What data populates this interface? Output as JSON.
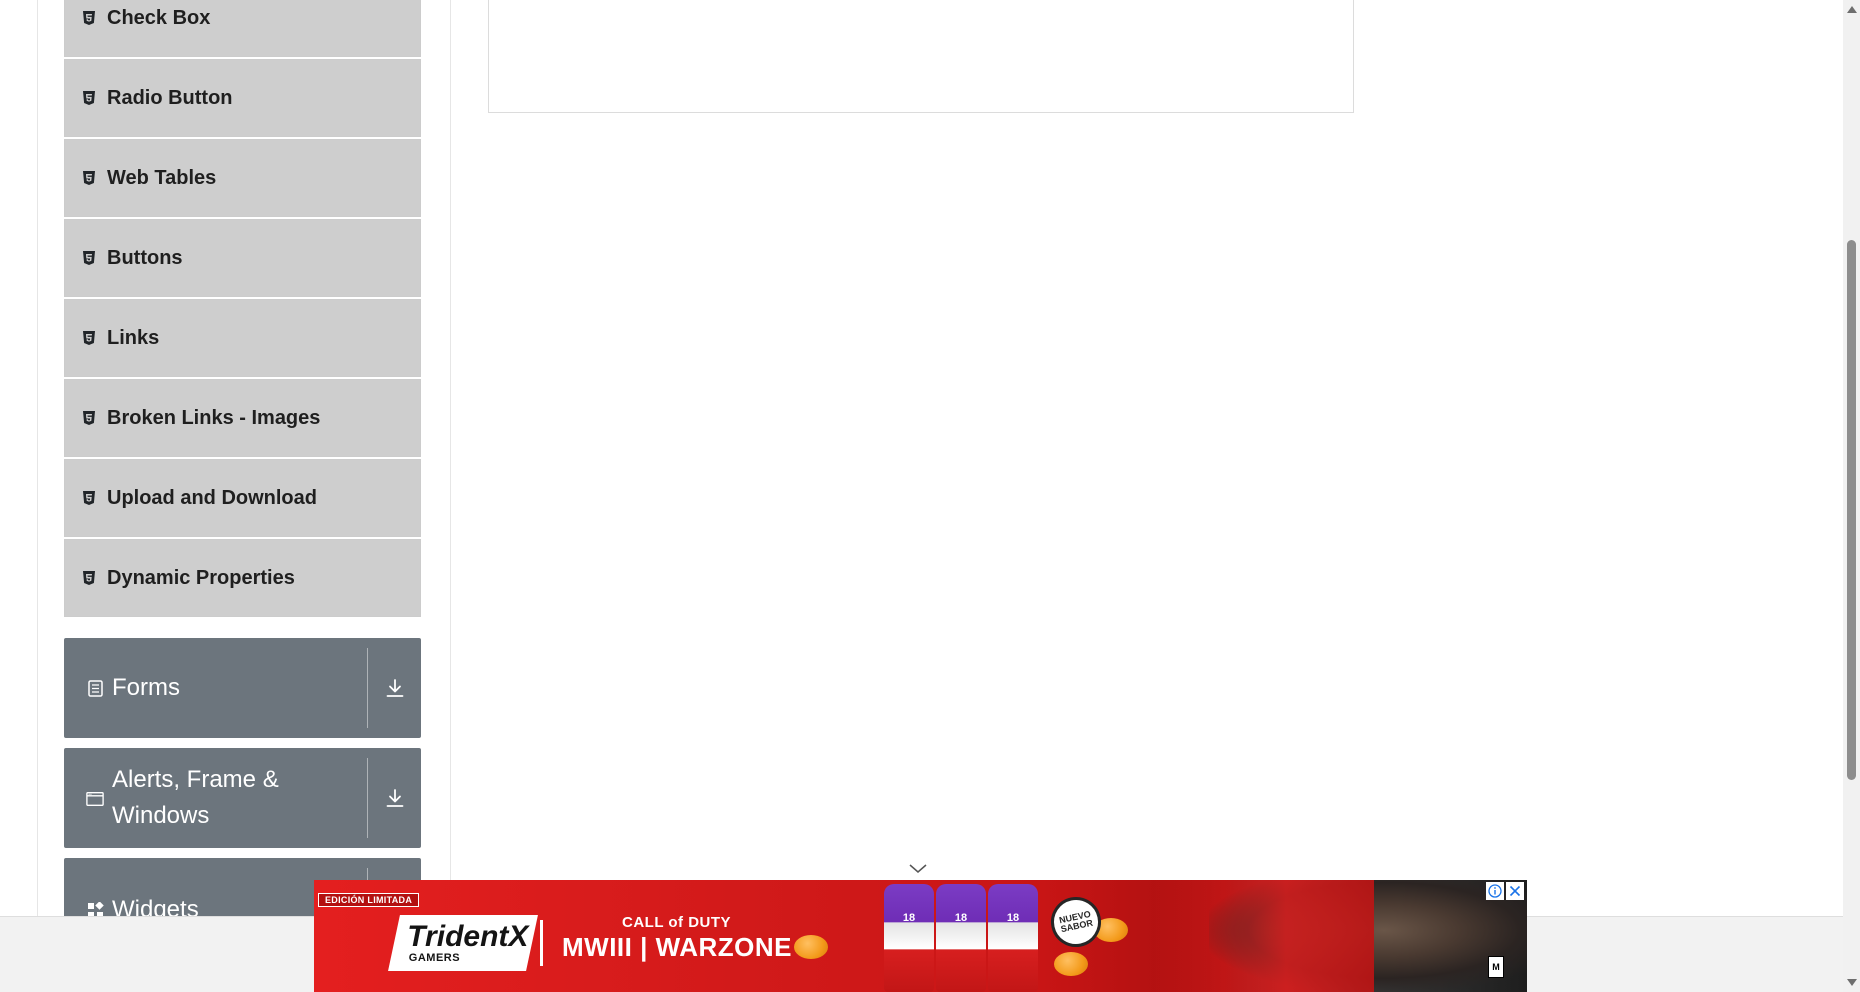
{
  "sidebar": {
    "element_items": [
      {
        "label": "Check Box",
        "icon": "html5-icon"
      },
      {
        "label": "Radio Button",
        "icon": "html5-icon"
      },
      {
        "label": "Web Tables",
        "icon": "html5-icon"
      },
      {
        "label": "Buttons",
        "icon": "html5-icon"
      },
      {
        "label": "Links",
        "icon": "html5-icon"
      },
      {
        "label": "Broken Links - Images",
        "icon": "html5-icon"
      },
      {
        "label": "Upload and Download",
        "icon": "html5-icon"
      },
      {
        "label": "Dynamic Properties",
        "icon": "html5-icon"
      }
    ],
    "groups": [
      {
        "label": "Forms",
        "icon": "form-icon",
        "toggle_icon": "download-arrow-icon"
      },
      {
        "label": "Alerts, Frame & Windows",
        "icon": "window-icon",
        "toggle_icon": "download-arrow-icon"
      },
      {
        "label": "Widgets",
        "icon": "widgets-icon",
        "toggle_icon": "download-arrow-icon"
      }
    ]
  },
  "ad": {
    "badge": "EDICIÓN LIMITADA",
    "brand": "TridentX",
    "brand_sub": "GAMERS",
    "game_line1": "CALL of DUTY",
    "game_line2": "MWIII | WARZONE",
    "can_label": "18",
    "seal": "NUEVO SABOR",
    "rating": "M",
    "collapse_icon": "chevron-down-icon",
    "info_icon": "info-icon",
    "close_icon": "close-icon"
  },
  "colors": {
    "item_bg": "#cecece",
    "group_bg": "#6c757d",
    "ad_red": "#d21a1a"
  }
}
